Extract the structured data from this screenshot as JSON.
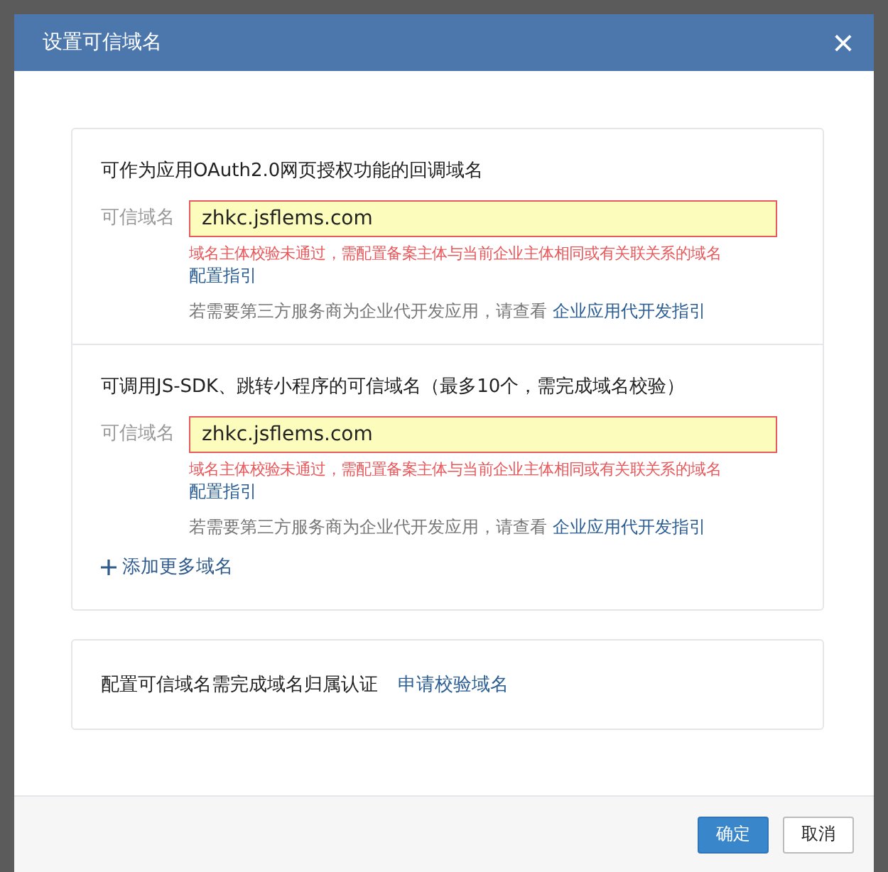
{
  "dialog": {
    "title": "设置可信域名",
    "close": "×"
  },
  "sections": [
    {
      "heading": "可作为应用OAuth2.0网页授权功能的回调域名",
      "field_label": "可信域名",
      "value": "zhkc.jsflems.com",
      "invalid": true,
      "error": "域名主体校验未通过，需配置备案主体与当前企业主体相同或有关联关系的域名",
      "error_link": "配置指引",
      "hint": "若需要第三方服务商为企业代开发应用，请查看",
      "hint_link": "企业应用代开发指引"
    },
    {
      "heading": "可调用JS-SDK、跳转小程序的可信域名（最多10个，需完成域名校验）",
      "field_label": "可信域名",
      "value": "zhkc.jsflems.com",
      "invalid": true,
      "error": "域名主体校验未通过，需配置备案主体与当前企业主体相同或有关联关系的域名",
      "error_link": "配置指引",
      "hint": "若需要第三方服务商为企业代开发应用，请查看",
      "hint_link": "企业应用代开发指引",
      "add_more": "添加更多域名"
    }
  ],
  "verify": {
    "text": "配置可信域名需完成域名归属认证",
    "link": "申请校验域名"
  },
  "buttons": [
    {
      "label": "确定",
      "kind": "primary"
    },
    {
      "label": "取消",
      "kind": "default"
    }
  ]
}
